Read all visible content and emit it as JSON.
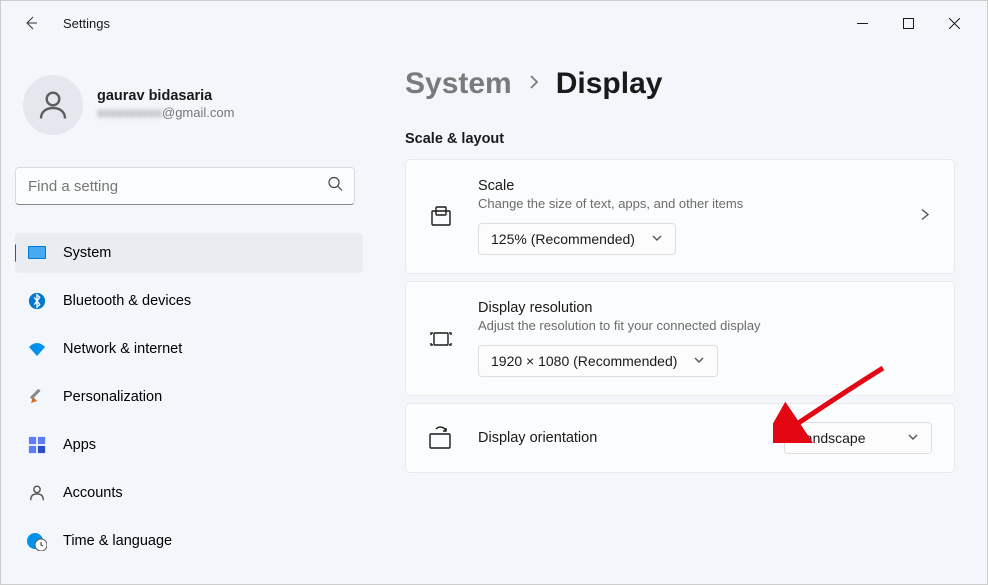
{
  "app": {
    "title": "Settings"
  },
  "profile": {
    "name": "gaurav bidasaria",
    "email_prefix": "xxxxxxxxxx",
    "email_suffix": "@gmail.com"
  },
  "search": {
    "placeholder": "Find a setting"
  },
  "nav": {
    "items": [
      {
        "label": "System"
      },
      {
        "label": "Bluetooth & devices"
      },
      {
        "label": "Network & internet"
      },
      {
        "label": "Personalization"
      },
      {
        "label": "Apps"
      },
      {
        "label": "Accounts"
      },
      {
        "label": "Time & language"
      }
    ]
  },
  "breadcrumb": {
    "parent": "System",
    "current": "Display"
  },
  "section": {
    "label": "Scale & layout"
  },
  "cards": {
    "scale": {
      "title": "Scale",
      "desc": "Change the size of text, apps, and other items",
      "value": "125% (Recommended)"
    },
    "resolution": {
      "title": "Display resolution",
      "desc": "Adjust the resolution to fit your connected display",
      "value": "1920 × 1080 (Recommended)"
    },
    "orientation": {
      "title": "Display orientation",
      "value": "Landscape"
    }
  }
}
